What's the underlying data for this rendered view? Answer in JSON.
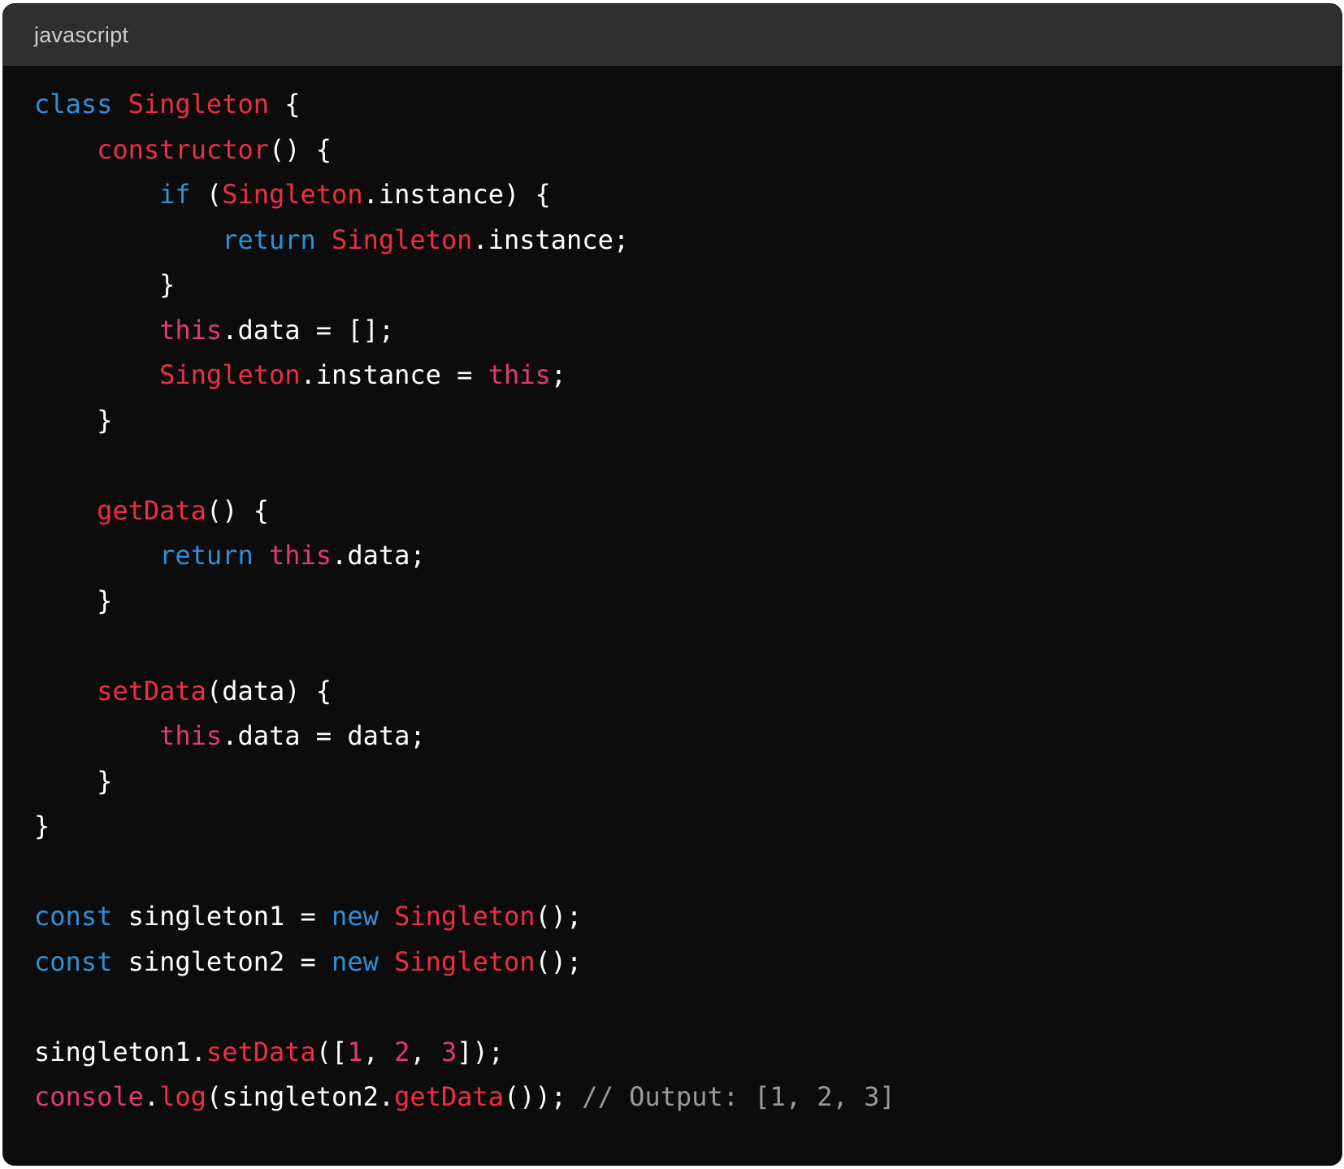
{
  "header": {
    "language": "javascript"
  },
  "colors": {
    "background": "#0c0c0c",
    "header_bg": "#2f2f2f",
    "keyword": "#2f8fd8",
    "class_name": "#ee2d47",
    "function": "#ee2d47",
    "this_and_numbers": "#e23a72",
    "comment": "#9a9a9a",
    "plain": "#ffffff"
  },
  "code": {
    "lines": [
      [
        {
          "t": "class",
          "k": "keyword"
        },
        {
          "t": " ",
          "k": "plain"
        },
        {
          "t": "Singleton",
          "k": "class"
        },
        {
          "t": " {",
          "k": "plain"
        }
      ],
      [
        {
          "t": "    ",
          "k": "plain"
        },
        {
          "t": "constructor",
          "k": "func"
        },
        {
          "t": "() {",
          "k": "plain"
        }
      ],
      [
        {
          "t": "        ",
          "k": "plain"
        },
        {
          "t": "if",
          "k": "keyword"
        },
        {
          "t": " (",
          "k": "plain"
        },
        {
          "t": "Singleton",
          "k": "class"
        },
        {
          "t": ".instance) {",
          "k": "plain"
        }
      ],
      [
        {
          "t": "            ",
          "k": "plain"
        },
        {
          "t": "return",
          "k": "keyword"
        },
        {
          "t": " ",
          "k": "plain"
        },
        {
          "t": "Singleton",
          "k": "class"
        },
        {
          "t": ".instance;",
          "k": "plain"
        }
      ],
      [
        {
          "t": "        }",
          "k": "plain"
        }
      ],
      [
        {
          "t": "        ",
          "k": "plain"
        },
        {
          "t": "this",
          "k": "this"
        },
        {
          "t": ".data = [];",
          "k": "plain"
        }
      ],
      [
        {
          "t": "        ",
          "k": "plain"
        },
        {
          "t": "Singleton",
          "k": "class"
        },
        {
          "t": ".instance = ",
          "k": "plain"
        },
        {
          "t": "this",
          "k": "this"
        },
        {
          "t": ";",
          "k": "plain"
        }
      ],
      [
        {
          "t": "    }",
          "k": "plain"
        }
      ],
      [],
      [
        {
          "t": "    ",
          "k": "plain"
        },
        {
          "t": "getData",
          "k": "func"
        },
        {
          "t": "() {",
          "k": "plain"
        }
      ],
      [
        {
          "t": "        ",
          "k": "plain"
        },
        {
          "t": "return",
          "k": "keyword"
        },
        {
          "t": " ",
          "k": "plain"
        },
        {
          "t": "this",
          "k": "this"
        },
        {
          "t": ".data;",
          "k": "plain"
        }
      ],
      [
        {
          "t": "    }",
          "k": "plain"
        }
      ],
      [],
      [
        {
          "t": "    ",
          "k": "plain"
        },
        {
          "t": "setData",
          "k": "func"
        },
        {
          "t": "(data) {",
          "k": "plain"
        }
      ],
      [
        {
          "t": "        ",
          "k": "plain"
        },
        {
          "t": "this",
          "k": "this"
        },
        {
          "t": ".data = data;",
          "k": "plain"
        }
      ],
      [
        {
          "t": "    }",
          "k": "plain"
        }
      ],
      [
        {
          "t": "}",
          "k": "plain"
        }
      ],
      [],
      [
        {
          "t": "const",
          "k": "keyword"
        },
        {
          "t": " singleton1 = ",
          "k": "plain"
        },
        {
          "t": "new",
          "k": "keyword"
        },
        {
          "t": " ",
          "k": "plain"
        },
        {
          "t": "Singleton",
          "k": "class"
        },
        {
          "t": "();",
          "k": "plain"
        }
      ],
      [
        {
          "t": "const",
          "k": "keyword"
        },
        {
          "t": " singleton2 = ",
          "k": "plain"
        },
        {
          "t": "new",
          "k": "keyword"
        },
        {
          "t": " ",
          "k": "plain"
        },
        {
          "t": "Singleton",
          "k": "class"
        },
        {
          "t": "();",
          "k": "plain"
        }
      ],
      [],
      [
        {
          "t": "singleton1.",
          "k": "plain"
        },
        {
          "t": "setData",
          "k": "func"
        },
        {
          "t": "([",
          "k": "plain"
        },
        {
          "t": "1",
          "k": "number"
        },
        {
          "t": ", ",
          "k": "plain"
        },
        {
          "t": "2",
          "k": "number"
        },
        {
          "t": ", ",
          "k": "plain"
        },
        {
          "t": "3",
          "k": "number"
        },
        {
          "t": "]);",
          "k": "plain"
        }
      ],
      [
        {
          "t": "console",
          "k": "this"
        },
        {
          "t": ".",
          "k": "plain"
        },
        {
          "t": "log",
          "k": "func"
        },
        {
          "t": "(singleton2.",
          "k": "plain"
        },
        {
          "t": "getData",
          "k": "func"
        },
        {
          "t": "()); ",
          "k": "plain"
        },
        {
          "t": "// Output: [1, 2, 3]",
          "k": "comment"
        }
      ]
    ]
  }
}
